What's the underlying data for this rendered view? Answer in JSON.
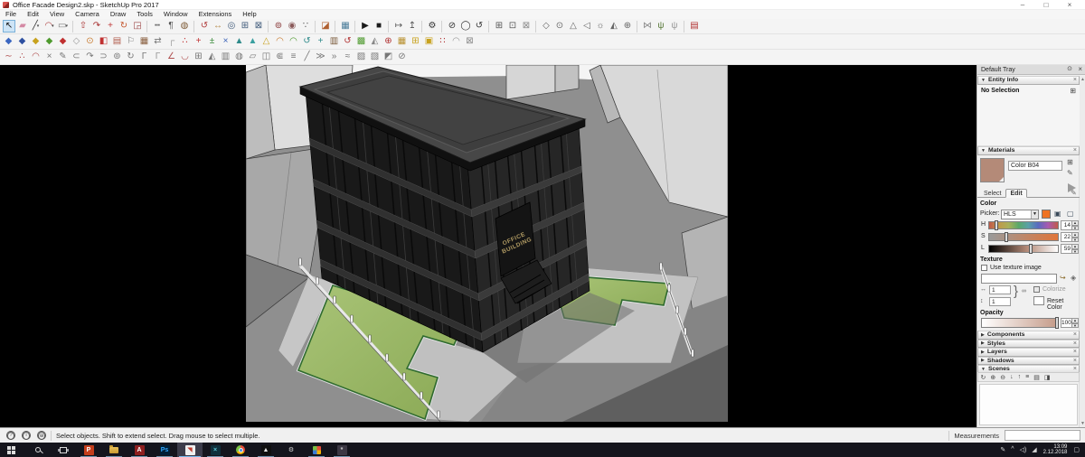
{
  "window": {
    "title": "Office Facade Design2.skp - SketchUp Pro 2017",
    "minimize": "–",
    "maximize": "□",
    "close": "×"
  },
  "menu": {
    "items": [
      {
        "name": "menu-file",
        "label": "File"
      },
      {
        "name": "menu-edit",
        "label": "Edit"
      },
      {
        "name": "menu-view",
        "label": "View"
      },
      {
        "name": "menu-camera",
        "label": "Camera"
      },
      {
        "name": "menu-draw",
        "label": "Draw"
      },
      {
        "name": "menu-tools",
        "label": "Tools"
      },
      {
        "name": "menu-window",
        "label": "Window"
      },
      {
        "name": "menu-extensions",
        "label": "Extensions"
      },
      {
        "name": "menu-help",
        "label": "Help"
      }
    ]
  },
  "toolbars": {
    "row1": [
      {
        "name": "select-tool",
        "glyph": "↖",
        "color": "#111111",
        "active": true
      },
      {
        "name": "eraser-tool",
        "glyph": "▰",
        "color": "#d489a4"
      },
      {
        "name": "line-tool",
        "glyph": "╱",
        "color": "#333333",
        "dropdown": true
      },
      {
        "name": "arc-tool",
        "glyph": "◠",
        "color": "#b04545",
        "dropdown": true
      },
      {
        "name": "rectangle-tool",
        "glyph": "▭",
        "color": "#777777",
        "dropdown": true
      },
      {
        "sep": true
      },
      {
        "name": "push-pull-tool",
        "glyph": "⇧",
        "color": "#a83232"
      },
      {
        "name": "follow-me-tool",
        "glyph": "↷",
        "color": "#a83232"
      },
      {
        "name": "move-tool",
        "glyph": "+",
        "color": "#c03a3a"
      },
      {
        "name": "rotate-tool",
        "glyph": "↻",
        "color": "#c4562e"
      },
      {
        "name": "scale-tool",
        "glyph": "◲",
        "color": "#9c4444"
      },
      {
        "sep": true
      },
      {
        "name": "tape-measure-tool",
        "glyph": "┅",
        "color": "#555555"
      },
      {
        "name": "text-tool",
        "glyph": "¶",
        "color": "#555555"
      },
      {
        "name": "paint-bucket-tool",
        "glyph": "◍",
        "color": "#7d5a36"
      },
      {
        "sep": true
      },
      {
        "name": "orbit-tool",
        "glyph": "↺",
        "color": "#b03a3a"
      },
      {
        "name": "pan-tool",
        "glyph": "↔",
        "color": "#b58a4a"
      },
      {
        "name": "zoom-tool",
        "glyph": "◎",
        "color": "#3f5a7a"
      },
      {
        "name": "zoom-window-tool",
        "glyph": "⊞",
        "color": "#3f5a7a"
      },
      {
        "name": "zoom-extents-tool",
        "glyph": "⊠",
        "color": "#3f5a7a"
      },
      {
        "sep": true
      },
      {
        "name": "position-camera-tool",
        "glyph": "⊚",
        "color": "#8a3a3a"
      },
      {
        "name": "look-around-tool",
        "glyph": "◉",
        "color": "#8a5a5a"
      },
      {
        "name": "walk-tool",
        "glyph": "∵",
        "color": "#555555"
      },
      {
        "sep": true
      },
      {
        "name": "section-plane-tool",
        "glyph": "◪",
        "color": "#b06030"
      },
      {
        "sep": true
      },
      {
        "name": "add-location-button",
        "glyph": "▦",
        "color": "#4a7c99"
      },
      {
        "sep": true
      },
      {
        "name": "play-animation-button",
        "glyph": "▶",
        "color": "#1a1a1a"
      },
      {
        "name": "stop-animation-button",
        "glyph": "■",
        "color": "#1a1a1a"
      },
      {
        "sep": true
      },
      {
        "name": "camera-path-button",
        "glyph": "↦",
        "color": "#555555"
      },
      {
        "name": "camera-keyframe-button",
        "glyph": "↥",
        "color": "#555555"
      },
      {
        "sep": true
      },
      {
        "name": "preferences-button",
        "glyph": "⚙",
        "color": "#333333"
      },
      {
        "sep": true
      },
      {
        "name": "vray-interactive-render-button",
        "glyph": "⊘",
        "color": "#333333"
      },
      {
        "name": "vray-render-button",
        "glyph": "◯",
        "color": "#333333"
      },
      {
        "name": "vray-rt-button",
        "glyph": "↺",
        "color": "#333333"
      },
      {
        "sep": true
      },
      {
        "name": "vray-frame-buffer-button",
        "glyph": "⊞",
        "color": "#555555"
      },
      {
        "name": "vray-batch-render-button",
        "glyph": "⊡",
        "color": "#555555"
      },
      {
        "name": "vray-lock-camera-button",
        "glyph": "⊠",
        "color": "#888888"
      },
      {
        "sep": true
      },
      {
        "name": "vray-infinite-plane-button",
        "glyph": "◇",
        "color": "#666666"
      },
      {
        "name": "vray-proxy-button",
        "glyph": "⊙",
        "color": "#666666"
      },
      {
        "name": "vray-clipper-button",
        "glyph": "△",
        "color": "#666666"
      },
      {
        "name": "vray-fur-button",
        "glyph": "◁",
        "color": "#666666"
      },
      {
        "name": "vray-sphere-light-button",
        "glyph": "☼",
        "color": "#666666"
      },
      {
        "name": "vray-dome-light-button",
        "glyph": "◭",
        "color": "#666666"
      },
      {
        "name": "vray-rect-light-button",
        "glyph": "⊕",
        "color": "#666666"
      },
      {
        "sep": true
      },
      {
        "name": "sandbox-flip-button",
        "glyph": "⋈",
        "color": "#888888"
      },
      {
        "name": "fur-grass-button",
        "glyph": "ψ",
        "color": "#5a7a3a"
      },
      {
        "name": "fur-preset-button",
        "glyph": "ψ",
        "color": "#999999"
      },
      {
        "sep": true
      },
      {
        "name": "brick-material-button",
        "glyph": "▤",
        "color": "#b03030"
      }
    ],
    "row2": [
      {
        "name": "ext-tool-01",
        "glyph": "◆",
        "color": "#3a66c0"
      },
      {
        "name": "ext-tool-02",
        "glyph": "◆",
        "color": "#2e50a0"
      },
      {
        "name": "ext-tool-03",
        "glyph": "◆",
        "color": "#c8a21e"
      },
      {
        "name": "ext-tool-04",
        "glyph": "◆",
        "color": "#4e9a2e"
      },
      {
        "name": "ext-tool-05",
        "glyph": "◆",
        "color": "#c03030"
      },
      {
        "name": "ext-tool-06",
        "glyph": "◇",
        "color": "#9a9a9a"
      },
      {
        "name": "ext-tool-07",
        "glyph": "⊙",
        "color": "#c87a2e"
      },
      {
        "name": "ext-tool-08",
        "glyph": "◧",
        "color": "#c03030"
      },
      {
        "name": "ext-tool-09",
        "glyph": "▤",
        "color": "#b05a4a"
      },
      {
        "name": "ext-tool-10",
        "glyph": "⚐",
        "color": "#777777"
      },
      {
        "name": "ext-tool-11",
        "glyph": "▦",
        "color": "#8a6040"
      },
      {
        "name": "ext-tool-12",
        "glyph": "⇄",
        "color": "#777777"
      },
      {
        "name": "ext-tool-13",
        "glyph": "┌",
        "color": "#999999"
      },
      {
        "name": "ext-tool-14",
        "glyph": "∴",
        "color": "#c03030"
      },
      {
        "name": "ext-tool-15",
        "glyph": "+",
        "color": "#c03030"
      },
      {
        "name": "ext-tool-16",
        "glyph": "±",
        "color": "#3a8a3a"
      },
      {
        "name": "ext-tool-17",
        "glyph": "×",
        "color": "#3a62b8"
      },
      {
        "name": "ext-tool-18",
        "glyph": "▲",
        "color": "#2e8a8a"
      },
      {
        "name": "ext-tool-19",
        "glyph": "▲",
        "color": "#3aa0a0"
      },
      {
        "name": "ext-tool-20",
        "glyph": "△",
        "color": "#c8a21e"
      },
      {
        "name": "ext-tool-21",
        "glyph": "◠",
        "color": "#c87a2e"
      },
      {
        "name": "ext-tool-22",
        "glyph": "◠",
        "color": "#4e9a2e"
      },
      {
        "name": "ext-tool-23",
        "glyph": "↺",
        "color": "#2e8a8a"
      },
      {
        "name": "ext-tool-24",
        "glyph": "+",
        "color": "#2e8a8a"
      },
      {
        "name": "ext-tool-25",
        "glyph": "▥",
        "color": "#7a5a3a"
      },
      {
        "name": "ext-tool-26",
        "glyph": "↺",
        "color": "#b03030"
      },
      {
        "name": "ext-tool-27",
        "glyph": "▩",
        "color": "#4e9a2e"
      },
      {
        "name": "ext-tool-28",
        "glyph": "◭",
        "color": "#888888"
      },
      {
        "name": "ext-tool-29",
        "glyph": "⊕",
        "color": "#b03030"
      },
      {
        "name": "ext-tool-30",
        "glyph": "▦",
        "color": "#b8902e"
      },
      {
        "name": "ext-tool-31",
        "glyph": "⊞",
        "color": "#c8a21e"
      },
      {
        "name": "ext-tool-32",
        "glyph": "▣",
        "color": "#c8a21e"
      },
      {
        "name": "ext-tool-33",
        "glyph": "∷",
        "color": "#b03030"
      },
      {
        "name": "ext-tool-34",
        "glyph": "◠",
        "color": "#999999"
      },
      {
        "name": "ext-tool-35",
        "glyph": "⊠",
        "color": "#888888"
      }
    ],
    "row3": [
      {
        "name": "curve-tool-01",
        "glyph": "∼",
        "color": "#b05050"
      },
      {
        "name": "curve-tool-02",
        "glyph": "∴",
        "color": "#b05050"
      },
      {
        "name": "curve-tool-03",
        "glyph": "◠",
        "color": "#b05050"
      },
      {
        "name": "curve-tool-04",
        "glyph": "×",
        "color": "#777777"
      },
      {
        "name": "curve-tool-05",
        "glyph": "✎",
        "color": "#777777"
      },
      {
        "name": "curve-tool-06",
        "glyph": "⊂",
        "color": "#777777"
      },
      {
        "name": "curve-tool-07",
        "glyph": "↷",
        "color": "#777777"
      },
      {
        "name": "curve-tool-08",
        "glyph": "⊃",
        "color": "#777777"
      },
      {
        "name": "curve-tool-09",
        "glyph": "⊚",
        "color": "#777777"
      },
      {
        "name": "curve-tool-10",
        "glyph": "↻",
        "color": "#777777"
      },
      {
        "name": "curve-tool-11",
        "glyph": "Γ",
        "color": "#777777"
      },
      {
        "name": "curve-tool-12",
        "glyph": "Γ",
        "color": "#999999"
      },
      {
        "name": "curve-tool-13",
        "glyph": "∠",
        "color": "#b05050"
      },
      {
        "name": "curve-tool-14",
        "glyph": "◡",
        "color": "#b05050"
      },
      {
        "name": "curve-tool-15",
        "glyph": "⊞",
        "color": "#777777"
      },
      {
        "name": "curve-tool-16",
        "glyph": "◭",
        "color": "#777777"
      },
      {
        "name": "curve-tool-17",
        "glyph": "▥",
        "color": "#777777"
      },
      {
        "name": "curve-tool-18",
        "glyph": "◍",
        "color": "#777777"
      },
      {
        "name": "curve-tool-19",
        "glyph": "▱",
        "color": "#777777"
      },
      {
        "name": "curve-tool-20",
        "glyph": "◫",
        "color": "#777777"
      },
      {
        "name": "curve-tool-21",
        "glyph": "⋐",
        "color": "#777777"
      },
      {
        "name": "curve-tool-22",
        "glyph": "≡",
        "color": "#777777"
      },
      {
        "name": "curve-tool-23",
        "glyph": "╱",
        "color": "#777777"
      },
      {
        "name": "curve-tool-24",
        "glyph": "≫",
        "color": "#777777"
      },
      {
        "name": "curve-tool-25",
        "glyph": "»",
        "color": "#777777"
      },
      {
        "name": "curve-tool-26",
        "glyph": "≈",
        "color": "#777777"
      },
      {
        "name": "curve-tool-27",
        "glyph": "▨",
        "color": "#777777"
      },
      {
        "name": "curve-tool-28",
        "glyph": "▧",
        "color": "#777777"
      },
      {
        "name": "curve-tool-29",
        "glyph": "◩",
        "color": "#777777"
      },
      {
        "name": "curve-tool-30",
        "glyph": "⊘",
        "color": "#777777"
      }
    ]
  },
  "viewport": {
    "sign_line1": "OFFICE",
    "sign_line2": "BUILDING"
  },
  "tray": {
    "title": "Default Tray",
    "entity_info": {
      "title": "Entity Info",
      "status": "No Selection"
    },
    "materials": {
      "title": "Materials",
      "material_name": "Color B04",
      "swatch_color": "#b48a78",
      "tab_select": "Select",
      "tab_edit": "Edit",
      "color_label": "Color",
      "picker_label": "Picker:",
      "picker_value": "HLS",
      "picker_swatch_color": "#ee7223",
      "h_label": "H",
      "h_value": "14",
      "s_label": "S",
      "s_value": "22",
      "l_label": "L",
      "l_value": "59",
      "texture_label": "Texture",
      "use_texture_label": "Use texture image",
      "tex_w": "1",
      "tex_h": "1",
      "colorize_label": "Colorize",
      "reset_label": "Reset Color",
      "opacity_label": "Opacity",
      "opacity_value": "100"
    },
    "sections": [
      {
        "name": "section-components",
        "label": "Components"
      },
      {
        "name": "section-styles",
        "label": "Styles"
      },
      {
        "name": "section-layers",
        "label": "Layers"
      },
      {
        "name": "section-shadows",
        "label": "Shadows"
      },
      {
        "name": "section-scenes",
        "label": "Scenes",
        "expanded": true
      }
    ],
    "scenes_toolbar": [
      {
        "name": "update-scene-button",
        "glyph": "↻"
      },
      {
        "name": "add-scene-button",
        "glyph": "⊕"
      },
      {
        "name": "remove-scene-button",
        "glyph": "⊖"
      },
      {
        "name": "move-scene-down-button",
        "glyph": "↓"
      },
      {
        "name": "move-scene-up-button",
        "glyph": "↑"
      },
      {
        "name": "view-options-button",
        "glyph": "≡"
      },
      {
        "name": "show-details-button",
        "glyph": "▤"
      },
      {
        "name": "scene-options-button",
        "glyph": "◨"
      }
    ]
  },
  "statusbar": {
    "icons": [
      {
        "name": "help-icon",
        "glyph": "?",
        "cls": "circ"
      },
      {
        "name": "info-icon",
        "glyph": "i",
        "cls": "circ"
      },
      {
        "name": "geolocation-icon",
        "glyph": "⊕",
        "cls": "circ"
      }
    ],
    "message": "Select objects. Shift to extend select. Drag mouse to select multiple.",
    "measurements_label": "Measurements"
  },
  "taskbar": {
    "apps": [
      {
        "name": "start-button",
        "cls": "ic-start",
        "glyph": " "
      },
      {
        "name": "search-button",
        "cls": "ic-search",
        "glyph": " "
      },
      {
        "name": "task-view-button",
        "cls": "ic-taskview",
        "glyph": " "
      },
      {
        "name": "powerpoint-button",
        "cls": "ic-app",
        "glyph": "P",
        "bg": "#c43e1c",
        "fg": "#ffffff",
        "running": true
      },
      {
        "name": "file-explorer-button",
        "cls": "ic-folder",
        "glyph": " ",
        "running": true
      },
      {
        "name": "autocad-button",
        "cls": "ic-app",
        "glyph": "A",
        "bg": "#8e1f1f",
        "fg": "#ffffff",
        "running": true
      },
      {
        "name": "photoshop-button",
        "cls": "ic-app",
        "glyph": "Ps",
        "bg": "#001e36",
        "fg": "#31a8ff",
        "running": true
      },
      {
        "name": "sketchup-button",
        "cls": "ic-app",
        "glyph": "◥",
        "bg": "#efefef",
        "fg": "#c0392b",
        "running": true,
        "active": true
      },
      {
        "name": "3ds-max-button",
        "cls": "ic-app",
        "glyph": "×",
        "bg": "#10303c",
        "fg": "#5fc8d8",
        "running": true
      },
      {
        "name": "chrome-button",
        "cls": "ic-chrome",
        "glyph": " ",
        "running": true
      },
      {
        "name": "photos-button",
        "cls": "ic-app",
        "glyph": "▲",
        "bg": "#101010",
        "fg": "#e8e8e8",
        "running": true
      },
      {
        "name": "settings-button",
        "cls": "ic-app",
        "glyph": "⚙",
        "bg": "transparent",
        "fg": "#d8d8d8"
      },
      {
        "name": "media-app-button",
        "cls": "ic-pinwheel",
        "glyph": " ",
        "running": true
      },
      {
        "name": "graphics-app-button",
        "cls": "ic-app",
        "glyph": "*",
        "bg": "#3c3844",
        "fg": "#cfcfcf",
        "running": true
      }
    ],
    "tray_icons": [
      {
        "name": "pen-icon",
        "glyph": "✎"
      },
      {
        "name": "hidden-icons-chevron",
        "glyph": "^"
      },
      {
        "name": "speaker-icon",
        "glyph": "◁)"
      },
      {
        "name": "network-icon",
        "glyph": "◢"
      }
    ],
    "clock": {
      "time": "13:09",
      "date": "2.12.2018"
    },
    "action_center": "▢"
  }
}
